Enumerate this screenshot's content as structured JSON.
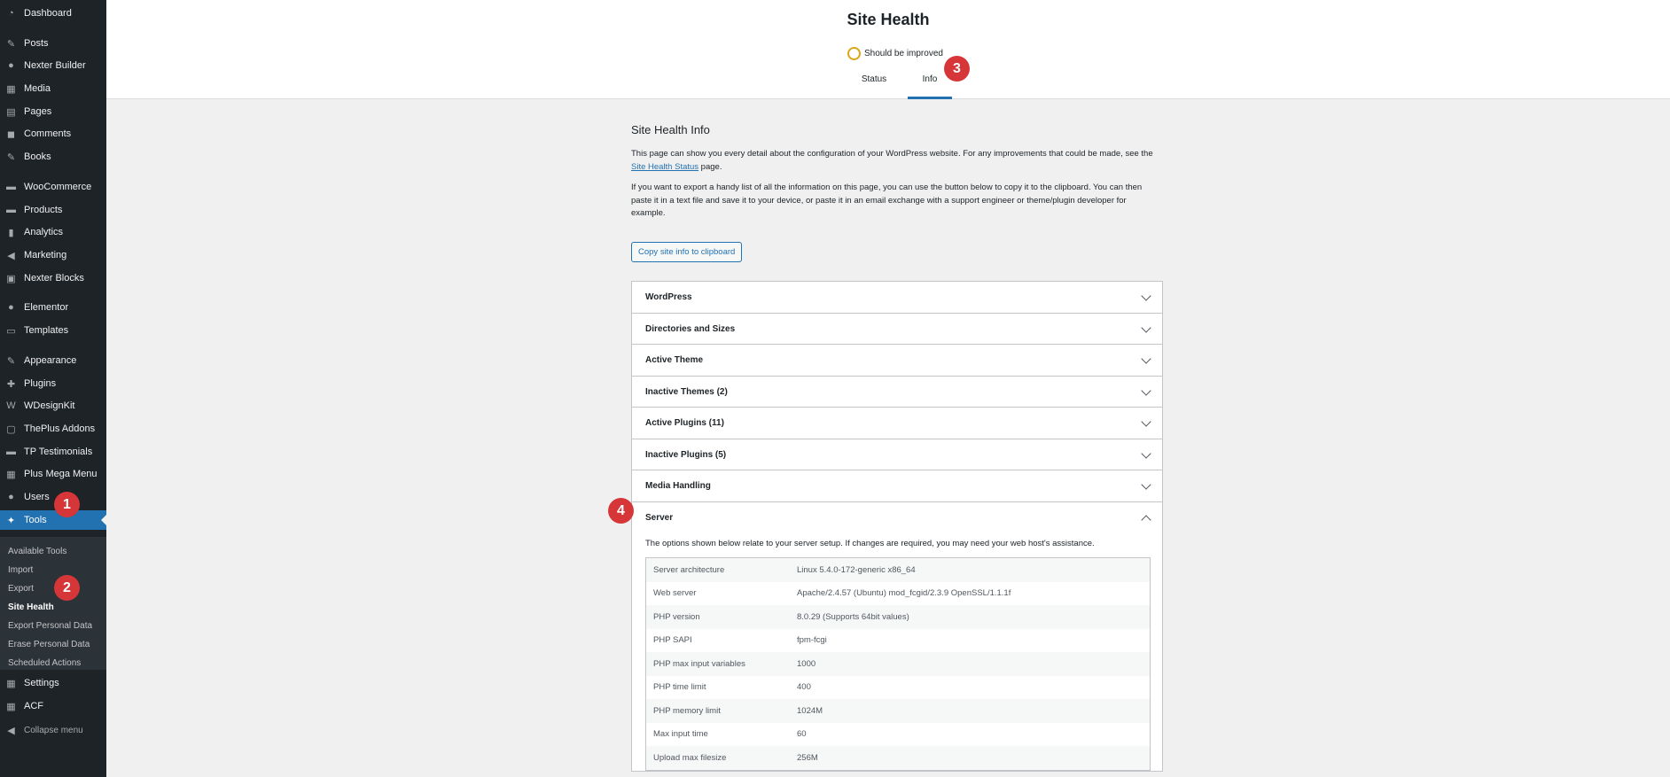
{
  "sidebar": {
    "items": [
      {
        "label": "Dashboard",
        "icon": "dashboard-icon",
        "glyph": "◔"
      },
      {
        "label": "Posts",
        "icon": "pin-icon",
        "glyph": "✎"
      },
      {
        "label": "Nexter Builder",
        "icon": "info-icon",
        "glyph": "●"
      },
      {
        "label": "Media",
        "icon": "media-icon",
        "glyph": "▦"
      },
      {
        "label": "Pages",
        "icon": "pages-icon",
        "glyph": "▤"
      },
      {
        "label": "Comments",
        "icon": "comment-icon",
        "glyph": "◼"
      },
      {
        "label": "Books",
        "icon": "pin-icon",
        "glyph": "✎"
      },
      {
        "label": "WooCommerce",
        "icon": "woo-icon",
        "glyph": "▬"
      },
      {
        "label": "Products",
        "icon": "archive-icon",
        "glyph": "▬"
      },
      {
        "label": "Analytics",
        "icon": "chart-icon",
        "glyph": "▮"
      },
      {
        "label": "Marketing",
        "icon": "megaphone-icon",
        "glyph": "◀"
      },
      {
        "label": "Nexter Blocks",
        "icon": "block-icon",
        "glyph": "▣"
      },
      {
        "label": "Elementor",
        "icon": "elementor-icon",
        "glyph": "●"
      },
      {
        "label": "Templates",
        "icon": "folder-icon",
        "glyph": "▭"
      },
      {
        "label": "Appearance",
        "icon": "brush-icon",
        "glyph": "✎"
      },
      {
        "label": "Plugins",
        "icon": "plugin-icon",
        "glyph": "✚"
      },
      {
        "label": "WDesignKit",
        "icon": "wdesignkit-icon",
        "glyph": "W"
      },
      {
        "label": "ThePlus Addons",
        "icon": "theplus-icon",
        "glyph": "▢"
      },
      {
        "label": "TP Testimonials",
        "icon": "testimonial-icon",
        "glyph": "▬"
      },
      {
        "label": "Plus Mega Menu",
        "icon": "megamenu-icon",
        "glyph": "▦"
      },
      {
        "label": "Users",
        "icon": "user-icon",
        "glyph": "●"
      },
      {
        "label": "Tools",
        "icon": "wrench-icon",
        "glyph": "✦"
      }
    ],
    "tools_submenu": [
      "Available Tools",
      "Import",
      "Export",
      "Site Health",
      "Export Personal Data",
      "Erase Personal Data",
      "Scheduled Actions"
    ],
    "bottom_items": [
      {
        "label": "Settings",
        "icon": "settings-icon",
        "glyph": "▦"
      },
      {
        "label": "ACF",
        "icon": "acf-icon",
        "glyph": "▦"
      }
    ],
    "collapse_label": "Collapse menu"
  },
  "header": {
    "title": "Site Health",
    "status_text": "Should be improved",
    "tabs": [
      "Status",
      "Info"
    ],
    "active_tab": "Info"
  },
  "callouts": [
    "1",
    "2",
    "3",
    "4"
  ],
  "info": {
    "heading": "Site Health Info",
    "para1_before": "This page can show you every detail about the configuration of your WordPress website. For any improvements that could be made, see the ",
    "para1_link": "Site Health Status",
    "para1_after": " page.",
    "para2": "If you want to export a handy list of all the information on this page, you can use the button below to copy it to the clipboard. You can then paste it in a text file and save it to your device, or paste it in an email exchange with a support engineer or theme/plugin developer for example.",
    "copy_button": "Copy site info to clipboard"
  },
  "accordion": {
    "sections": [
      "WordPress",
      "Directories and Sizes",
      "Active Theme",
      "Inactive Themes (2)",
      "Active Plugins (11)",
      "Inactive Plugins (5)",
      "Media Handling"
    ],
    "open_section": "Server",
    "server_description": "The options shown below relate to your server setup. If changes are required, you may need your web host's assistance.",
    "server_rows": [
      {
        "label": "Server architecture",
        "value": "Linux 5.4.0-172-generic x86_64"
      },
      {
        "label": "Web server",
        "value": "Apache/2.4.57 (Ubuntu) mod_fcgid/2.3.9 OpenSSL/1.1.1f"
      },
      {
        "label": "PHP version",
        "value": "8.0.29 (Supports 64bit values)"
      },
      {
        "label": "PHP SAPI",
        "value": "fpm-fcgi"
      },
      {
        "label": "PHP max input variables",
        "value": "1000"
      },
      {
        "label": "PHP time limit",
        "value": "400"
      },
      {
        "label": "PHP memory limit",
        "value": "1024M"
      },
      {
        "label": "Max input time",
        "value": "60"
      },
      {
        "label": "Upload max filesize",
        "value": "256M"
      }
    ]
  },
  "colors": {
    "accent": "#2271b1",
    "sidebar_bg": "#1d2327",
    "callout": "#d63638",
    "warning_ring": "#dba617"
  }
}
